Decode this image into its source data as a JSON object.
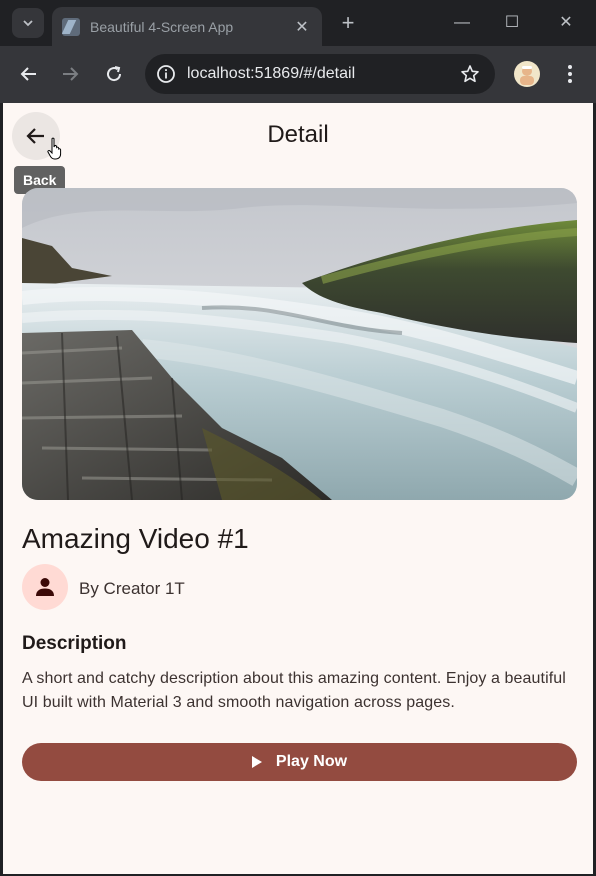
{
  "browser": {
    "tab_title": "Beautiful 4-Screen App",
    "url": "localhost:51869/#/detail",
    "icons": {
      "tab_search": "chevron-down-icon",
      "tab_close": "close-icon",
      "new_tab": "plus-icon",
      "minimize": "minimize-icon",
      "maximize": "maximize-icon",
      "close_window": "close-icon",
      "back": "arrow-left-icon",
      "forward": "arrow-right-icon",
      "reload": "reload-icon",
      "site_info": "info-icon",
      "bookmark": "star-icon",
      "menu": "kebab-icon"
    },
    "tab_close_glyph": "✕",
    "new_tab_glyph": "+",
    "min_glyph": "—",
    "max_glyph": "☐",
    "win_close_glyph": "✕"
  },
  "app": {
    "header": {
      "title": "Detail",
      "back_tooltip": "Back",
      "back_icon": "arrow-left-icon"
    },
    "hero_image": {
      "subject": "waterfall-landscape-photo"
    },
    "video": {
      "title": "Amazing Video #1",
      "creator": "By Creator 1T",
      "avatar_icon": "person-icon"
    },
    "description": {
      "heading": "Description",
      "text": "A short and catchy description about this amazing content. Enjoy a beautiful UI built with Material 3 and smooth navigation across pages."
    },
    "play_button": {
      "label": "Play Now",
      "icon": "play-icon"
    },
    "colors": {
      "background": "#fdf7f4",
      "primary": "#934b40",
      "avatar_bg": "#ffdad4",
      "text": "#201a19"
    }
  }
}
